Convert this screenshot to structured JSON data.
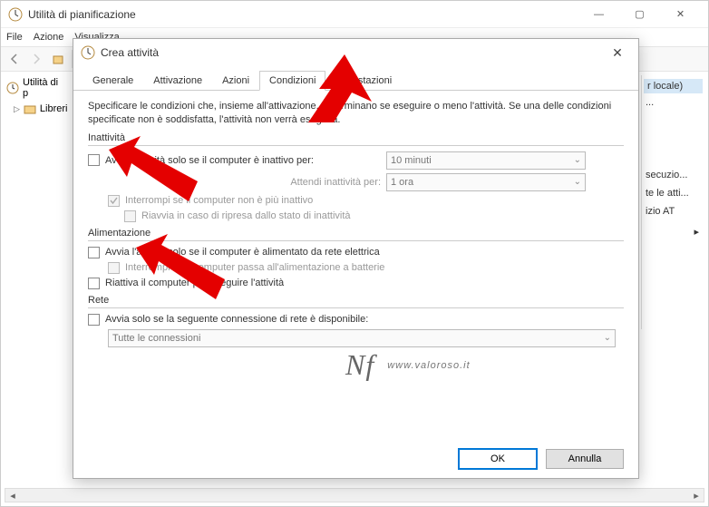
{
  "main": {
    "title": "Utilità di pianificazione",
    "menu": {
      "file": "File",
      "azione": "Azione",
      "visualizza": "Visualizza"
    },
    "tree": {
      "root": "Utilità di p",
      "lib": "Libreri"
    },
    "right": {
      "locale": "r locale)",
      "items": [
        "...",
        "secuzio...",
        "te le atti...",
        "izio AT"
      ]
    }
  },
  "dialog": {
    "title": "Crea attività",
    "tabs": {
      "generale": "Generale",
      "attivazione": "Attivazione",
      "azioni": "Azioni",
      "condizioni": "Condizioni",
      "impostazioni": "Impostazioni"
    },
    "desc": "Specificare le condizioni che, insieme all'attivazione, determinano se eseguire o meno l'attività. Se una delle condizioni specificate non è soddisfatta, l'attività non verrà eseguita.",
    "inattivita": {
      "group": "Inattività",
      "chk1": "Avvia l'attività solo se il computer è inattivo per:",
      "waitLabel": "Attendi inattività per:",
      "stopIdle": "Interrompi se il computer non è più inattivo",
      "restart": "Riavvia in caso di ripresa dallo stato di inattività",
      "idleDuration": "10 minuti",
      "waitDuration": "1 ora"
    },
    "alimentazione": {
      "group": "Alimentazione",
      "chk1": "Avvia l'attività solo se il computer è alimentato da rete elettrica",
      "stop": "Interrompi se il computer passa all'alimentazione a batterie",
      "wake": "Riattiva il computer per eseguire l'attività"
    },
    "rete": {
      "group": "Rete",
      "chk": "Avvia solo se la seguente connessione di rete è disponibile:",
      "combo": "Tutte le connessioni"
    },
    "buttons": {
      "ok": "OK",
      "cancel": "Annulla"
    }
  },
  "watermark": {
    "text": "www.valoroso.it"
  }
}
